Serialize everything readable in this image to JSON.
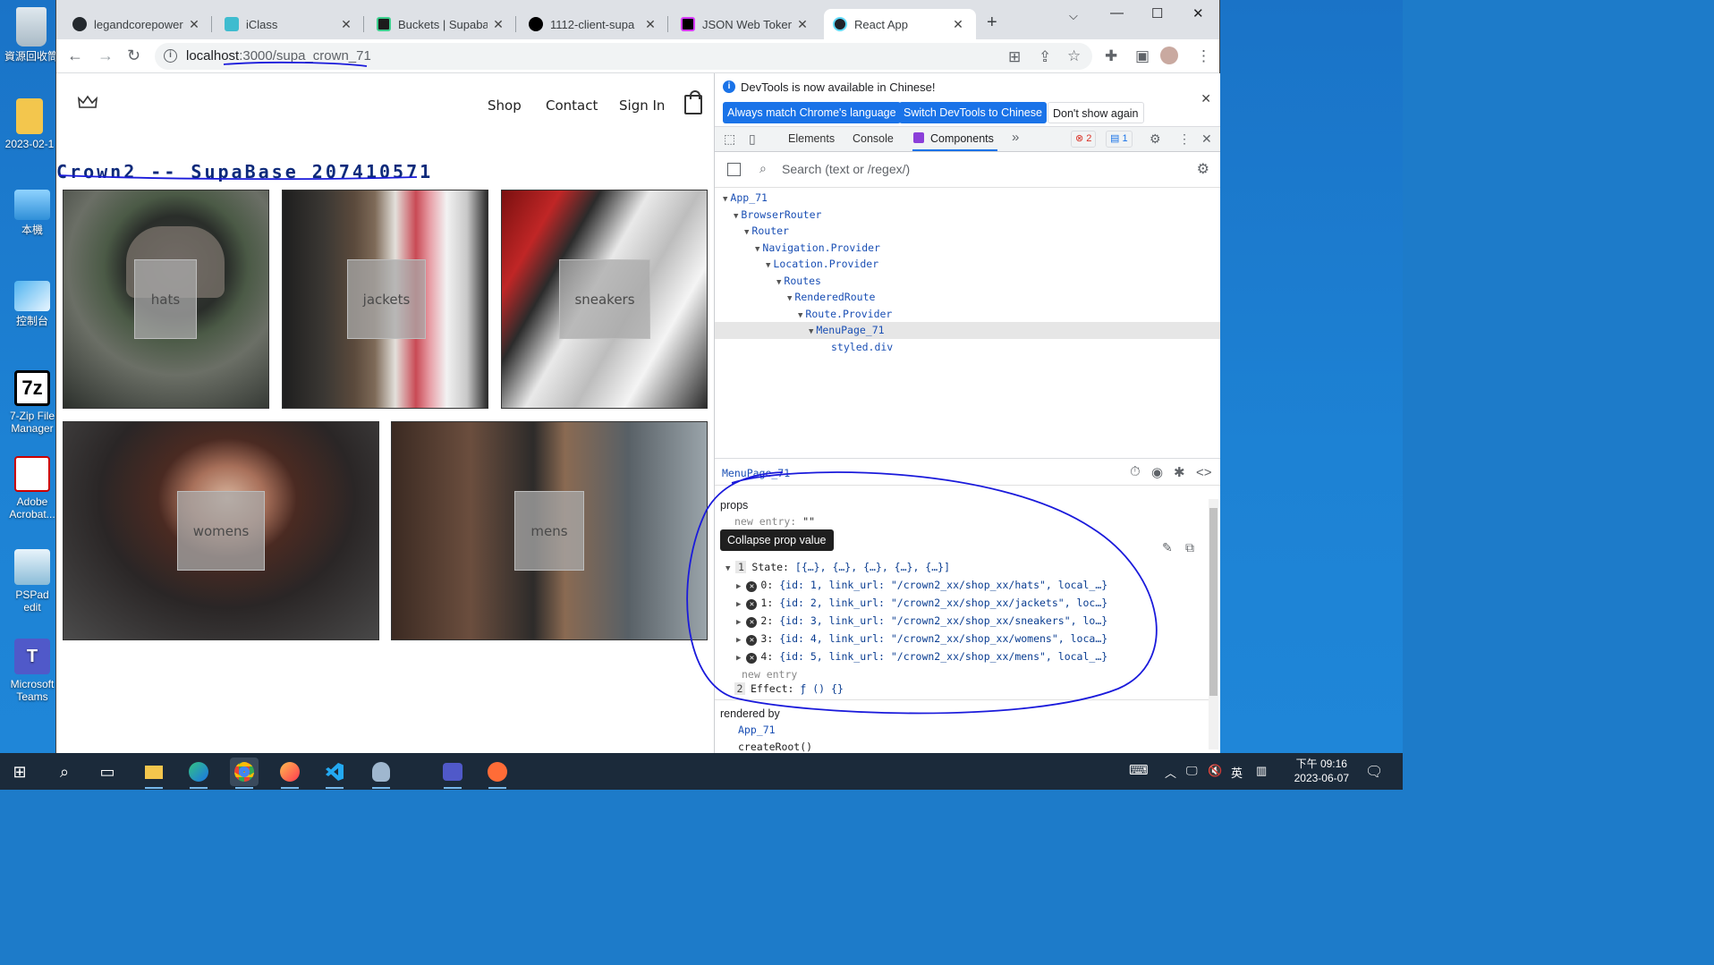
{
  "desktop_icons": [
    {
      "label": "資源回收筒",
      "icon": "recycle-bin-icon"
    },
    {
      "label": "2023-02-1",
      "icon": "folder-icon"
    },
    {
      "label": "本機",
      "icon": "computer-icon"
    },
    {
      "label": "控制台",
      "icon": "control-panel-icon"
    },
    {
      "label": "7-Zip File Manager",
      "icon": "7zip-icon"
    },
    {
      "label": "Adobe Acrobat...",
      "icon": "acrobat-icon"
    },
    {
      "label": "PSPad edit",
      "icon": "pspad-icon"
    },
    {
      "label": "Microsoft Teams",
      "icon": "teams-icon"
    }
  ],
  "browser": {
    "tabs": [
      {
        "label": "legandcorepower",
        "icon": "github-icon"
      },
      {
        "label": "iClass",
        "icon": "iclass-icon"
      },
      {
        "label": "Buckets | Supabas",
        "icon": "supabase-icon"
      },
      {
        "label": "1112-client-supa",
        "icon": "vercel-icon"
      },
      {
        "label": "JSON Web Tokens",
        "icon": "jwt-icon"
      },
      {
        "label": "React App",
        "icon": "react-icon"
      }
    ],
    "url_host": "localhost",
    "url_path": ":3000/supa_crown_71"
  },
  "site": {
    "nav": {
      "shop": "Shop",
      "contact": "Contact",
      "sign_in": "Sign In"
    },
    "title": "Crown2 -- SupaBase 207410571",
    "categories": [
      "hats",
      "jackets",
      "sneakers",
      "womens",
      "mens"
    ]
  },
  "devtools": {
    "infobar": {
      "message": "DevTools is now available in Chinese!",
      "btn_match": "Always match Chrome's language",
      "btn_switch": "Switch DevTools to Chinese",
      "btn_dismiss": "Don't show again"
    },
    "tabs": {
      "elements": "Elements",
      "console": "Console",
      "components": "Components"
    },
    "errors": "2",
    "messages": "1",
    "search_placeholder": "Search (text or /regex/)",
    "tree": [
      "App_71",
      "BrowserRouter",
      "Router",
      "Navigation.Provider",
      "Location.Provider",
      "Routes",
      "RenderedRoute",
      "Route.Provider",
      "MenuPage_71",
      "styled.div"
    ],
    "inspector": {
      "component": "MenuPage_71",
      "props_title": "props",
      "new_entry_label": "new entry:",
      "new_entry_value": "\"\"",
      "tooltip": "Collapse prop value",
      "state_index": "1",
      "state_label": "State:",
      "state_summary": "[{…}, {…}, {…}, {…}, {…}]",
      "state_items": [
        {
          "key": "0:",
          "value": "{id: 1, link_url: \"/crown2_xx/shop_xx/hats\", local_…}"
        },
        {
          "key": "1:",
          "value": "{id: 2, link_url: \"/crown2_xx/shop_xx/jackets\", loc…}"
        },
        {
          "key": "2:",
          "value": "{id: 3, link_url: \"/crown2_xx/shop_xx/sneakers\", lo…}"
        },
        {
          "key": "3:",
          "value": "{id: 4, link_url: \"/crown2_xx/shop_xx/womens\", loca…}"
        },
        {
          "key": "4:",
          "value": "{id: 5, link_url: \"/crown2_xx/shop_xx/mens\", local_…}"
        }
      ],
      "new_entry_footer": "new entry",
      "effect_index": "2",
      "effect_label": "Effect:",
      "effect_value": "ƒ () {}",
      "rendered_by": "rendered by",
      "rendered_by_items": [
        "App_71",
        "createRoot()"
      ]
    }
  },
  "taskbar": {
    "time": "下午 09:16",
    "date": "2023-06-07",
    "ime": "英"
  },
  "colors": {
    "desktop": "#1d7bc9",
    "annotation": "#1a1adb",
    "devtools_accent": "#1a73e8"
  }
}
